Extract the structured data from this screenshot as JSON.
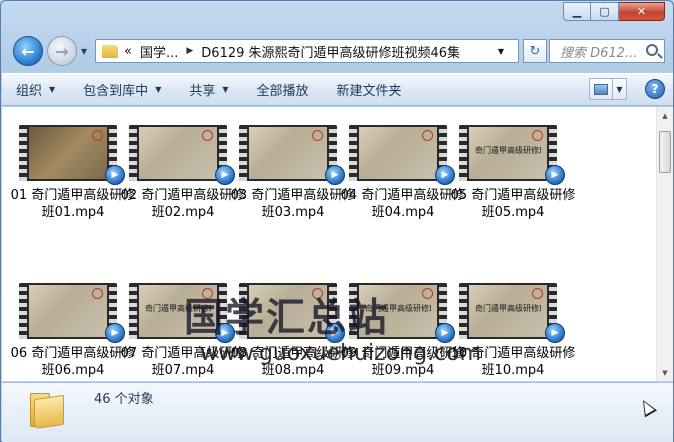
{
  "window": {
    "min_icon": "minimize-icon",
    "max_icon": "maximize-icon",
    "close_icon": "close-icon"
  },
  "nav": {
    "breadcrumb_prefix": "«",
    "breadcrumb": [
      "国学...",
      "D6129 朱源熙奇门遁甲高级研修班视频46集"
    ],
    "search_placeholder": "搜索 D612...",
    "refresh_icon": "refresh-icon"
  },
  "toolbar": {
    "organize": "组织",
    "include_library": "包含到库中",
    "share": "共享",
    "play_all": "全部播放",
    "new_folder": "新建文件夹",
    "help": "?"
  },
  "files": [
    {
      "label": "01 奇门遁甲高级研修班01.mp4",
      "thumb_text": ""
    },
    {
      "label": "02 奇门遁甲高级研修班02.mp4",
      "thumb_text": ""
    },
    {
      "label": "03 奇门遁甲高级研修班03.mp4",
      "thumb_text": ""
    },
    {
      "label": "04 奇门遁甲高级研修班04.mp4",
      "thumb_text": ""
    },
    {
      "label": "05 奇门遁甲高级研修班05.mp4",
      "thumb_text": "奇门遁甲高级研修班"
    },
    {
      "label": "06 奇门遁甲高级研修班06.mp4",
      "thumb_text": ""
    },
    {
      "label": "07 奇门遁甲高级研修班07.mp4",
      "thumb_text": "奇门遁甲高级研修班"
    },
    {
      "label": "08 奇门遁甲高级研修班08.mp4",
      "thumb_text": ""
    },
    {
      "label": "09 奇门遁甲高级研修班09.mp4",
      "thumb_text": "奇门遁甲高级研修班"
    },
    {
      "label": "10 奇门遁甲高级研修班10.mp4",
      "thumb_text": "奇门遁甲高级研修班"
    }
  ],
  "watermark": {
    "title": "国学汇总站",
    "url": "www.guoxuehuizong.com"
  },
  "status": {
    "count": "46 个对象"
  }
}
